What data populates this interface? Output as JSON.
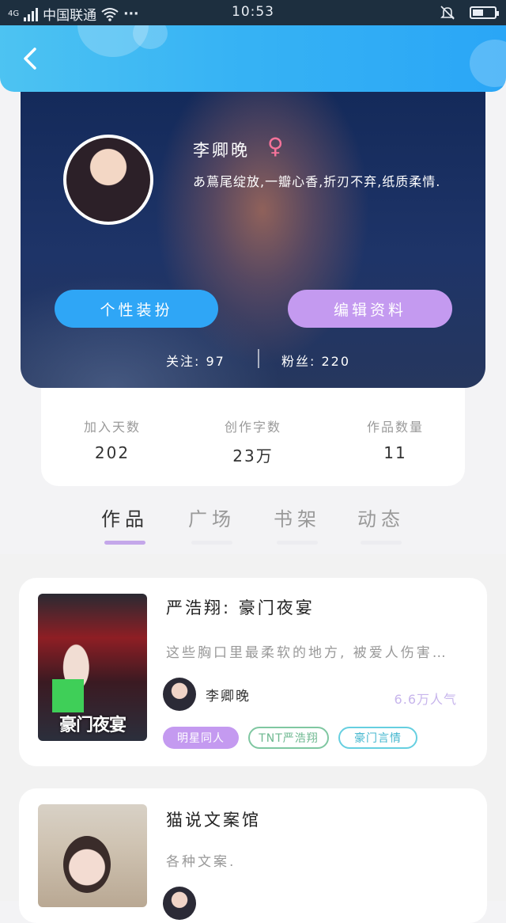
{
  "status_bar": {
    "network": "4G",
    "carrier": "中国联通",
    "more": "···",
    "time": "10:53",
    "battery_level": 0.5
  },
  "header": {
    "back_icon": "chevron-left-icon"
  },
  "profile": {
    "name": "李卿晚",
    "gender_symbol": "♀",
    "bio": "あ蔦尾绽放,一瓣心香,折刃不弃,纸质柔情.",
    "dress_button": "个性装扮",
    "edit_button": "编辑资料",
    "following": "关注: 97",
    "followers": "粉丝: 220"
  },
  "stats": [
    {
      "label": "加入天数",
      "value": "202"
    },
    {
      "label": "创作字数",
      "value": "23万"
    },
    {
      "label": "作品数量",
      "value": "11"
    }
  ],
  "tabs": [
    {
      "label": "作品",
      "active": true
    },
    {
      "label": "广场",
      "active": false
    },
    {
      "label": "书架",
      "active": false
    },
    {
      "label": "动态",
      "active": false
    }
  ],
  "works": [
    {
      "title": "严浩翔: 豪门夜宴",
      "cover_text": "豪门夜宴",
      "description": "这些胸口里最柔软的地方, 被爱人伤害…",
      "author": "李卿晚",
      "popularity": "6.6万人气",
      "tags": [
        "明星同人",
        "TNT严浩翔",
        "豪门言情"
      ]
    },
    {
      "title": "猫说文案馆",
      "description": "各种文案."
    }
  ],
  "colors": {
    "header_blue": "#37b3f4",
    "accent_purple": "#c49af0",
    "button_blue": "#2fa6f6"
  }
}
